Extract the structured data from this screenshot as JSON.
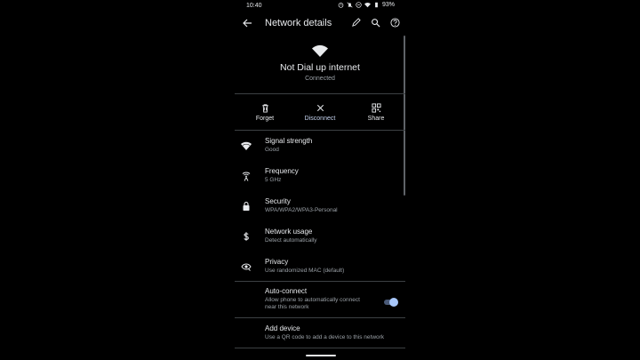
{
  "status_bar": {
    "time": "10:40",
    "battery": "93%"
  },
  "app_bar": {
    "title": "Network details"
  },
  "network": {
    "ssid": "Not Dial up internet",
    "state": "Connected"
  },
  "actions": [
    {
      "label": "Forget",
      "icon": "trash-icon"
    },
    {
      "label": "Disconnect",
      "icon": "close-icon"
    },
    {
      "label": "Share",
      "icon": "qr-code-icon"
    }
  ],
  "details": [
    {
      "title": "Signal strength",
      "value": "Good",
      "icon": "wifi-icon"
    },
    {
      "title": "Frequency",
      "value": "5 GHz",
      "icon": "antenna-icon"
    },
    {
      "title": "Security",
      "value": "WPA/WPA2/WPA3-Personal",
      "icon": "lock-icon"
    },
    {
      "title": "Network usage",
      "value": "Detect automatically",
      "icon": "dollar-icon"
    },
    {
      "title": "Privacy",
      "value": "Use randomized MAC (default)",
      "icon": "eye-icon"
    }
  ],
  "auto_connect": {
    "title": "Auto-connect",
    "desc_line1": "Allow phone to automatically connect",
    "desc_line2": "near this network",
    "enabled": true
  },
  "add_device": {
    "title": "Add device",
    "desc": "Use a QR code to add a device to this network"
  },
  "colors": {
    "background": "#000000",
    "text": "#e8eaed",
    "secondary": "#9aa0a6",
    "accent": "#a8c7fa"
  }
}
